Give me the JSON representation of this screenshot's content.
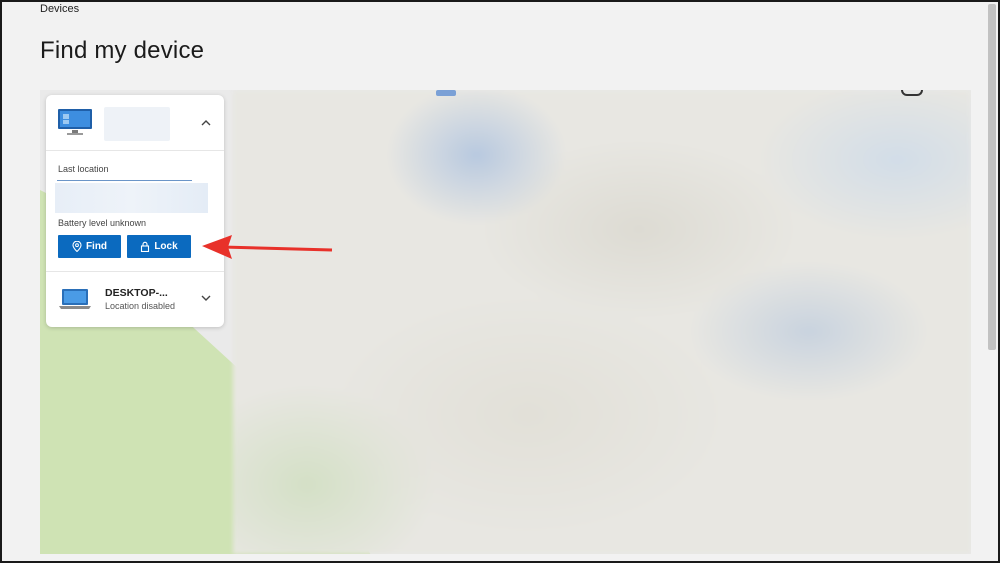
{
  "breadcrumb": "Devices",
  "title": "Find my device",
  "panel": {
    "device1": {
      "last_location_label": "Last location",
      "battery_text": "Battery level unknown",
      "find_label": "Find",
      "lock_label": "Lock"
    },
    "device2": {
      "name": "DESKTOP-...",
      "status": "Location disabled"
    }
  },
  "colors": {
    "accent": "#0b6abf",
    "annotation_arrow": "#e8312a",
    "map_green": "#cfe3b4"
  },
  "icons": [
    "monitor-icon",
    "chevron-up-icon",
    "location-pin-icon",
    "lock-icon",
    "laptop-icon",
    "chevron-down-icon"
  ]
}
